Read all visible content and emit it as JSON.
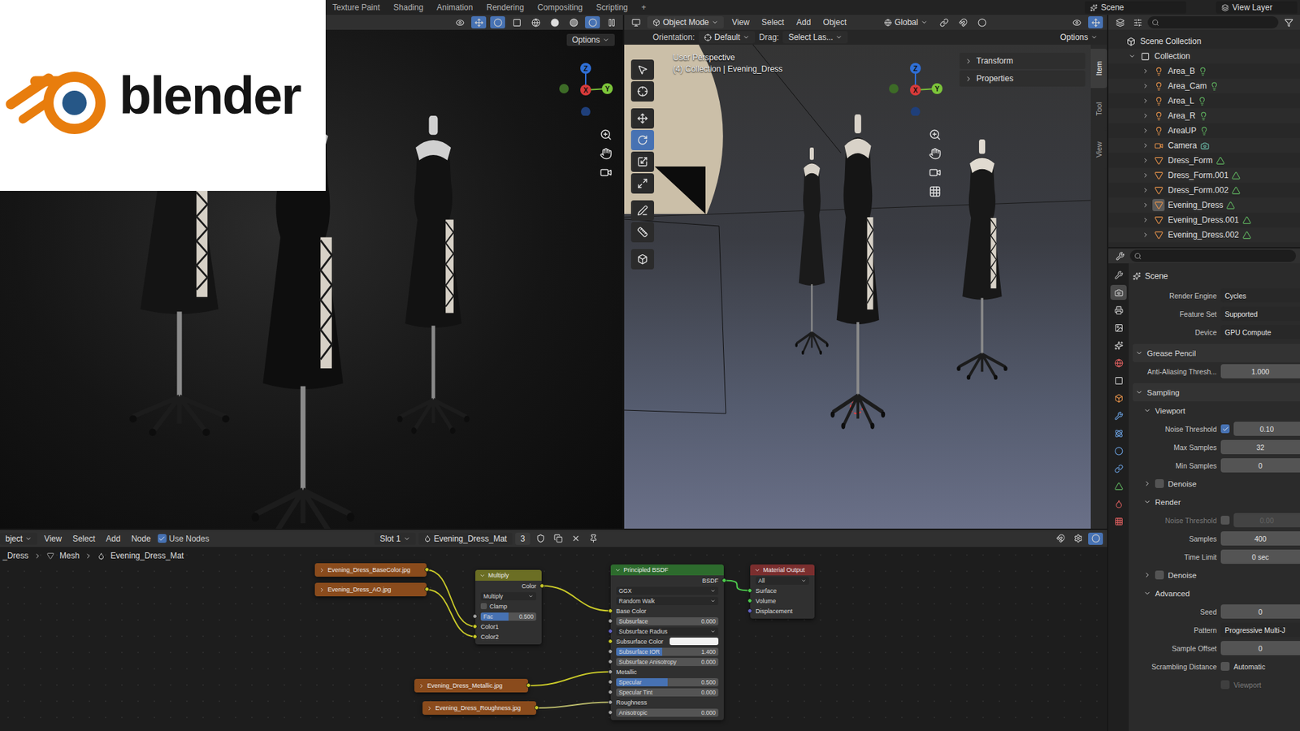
{
  "logo": {
    "text": "blender"
  },
  "workspace_tabs": [
    {
      "label": "Texture Paint",
      "selected": false
    },
    {
      "label": "Shading",
      "selected": false
    },
    {
      "label": "Animation",
      "selected": false
    },
    {
      "label": "Rendering",
      "selected": false
    },
    {
      "label": "Compositing",
      "selected": false
    },
    {
      "label": "Scripting",
      "selected": false
    }
  ],
  "add_workspace": "+",
  "scene": "Scene",
  "view_layer": "View Layer",
  "render_viewport": {
    "options": "Options",
    "gizmo_axes": [
      "Z",
      "X",
      "Y"
    ]
  },
  "viewport": {
    "mode": "Object Mode",
    "menus": [
      "View",
      "Select",
      "Add",
      "Object"
    ],
    "transform_orientation": "Global",
    "orientation_label": "Orientation:",
    "orientation": "Default",
    "drag_label": "Drag:",
    "drag": "Select Las...",
    "options": "Options",
    "perspective": "User Perspective",
    "context": "(4) Collection | Evening_Dress",
    "gizmo_axes": [
      "Z",
      "X",
      "Y"
    ],
    "tools": [
      {
        "selected": false
      },
      {
        "selected": false
      },
      {
        "selected": false
      },
      {
        "selected": true
      },
      {
        "selected": false
      },
      {
        "selected": false
      },
      {
        "selected": false
      },
      {
        "selected": false
      },
      {
        "selected": false
      }
    ],
    "sidebar_tabs": [
      {
        "label": "Item",
        "selected": true
      },
      {
        "label": "Tool",
        "selected": false
      },
      {
        "label": "View",
        "selected": false
      }
    ],
    "panels": [
      {
        "label": "Transform",
        "expanded": false
      },
      {
        "label": "Properties",
        "expanded": false
      }
    ]
  },
  "outliner": {
    "root": "Scene Collection",
    "collection": {
      "name": "Collection",
      "expanded": true
    },
    "items": [
      {
        "name": "Area_B",
        "kind": "light",
        "expanded": false,
        "active": false
      },
      {
        "name": "Area_Cam",
        "kind": "light",
        "expanded": false,
        "active": false
      },
      {
        "name": "Area_L",
        "kind": "light",
        "expanded": false,
        "active": false
      },
      {
        "name": "Area_R",
        "kind": "light",
        "expanded": false,
        "active": false
      },
      {
        "name": "AreaUP",
        "kind": "light",
        "expanded": false,
        "active": false
      },
      {
        "name": "Camera",
        "kind": "camera",
        "expanded": false,
        "active": false
      },
      {
        "name": "Dress_Form",
        "kind": "mesh",
        "expanded": false,
        "active": false
      },
      {
        "name": "Dress_Form.001",
        "kind": "mesh",
        "expanded": false,
        "active": false
      },
      {
        "name": "Dress_Form.002",
        "kind": "mesh",
        "expanded": false,
        "active": false
      },
      {
        "name": "Evening_Dress",
        "kind": "mesh",
        "expanded": false,
        "active": true
      },
      {
        "name": "Evening_Dress.001",
        "kind": "mesh",
        "expanded": false,
        "active": false
      },
      {
        "name": "Evening_Dress.002",
        "kind": "mesh",
        "expanded": false,
        "active": false
      }
    ]
  },
  "properties": {
    "tabs": [
      {
        "selected": false
      },
      {
        "selected": true
      },
      {
        "selected": false
      },
      {
        "selected": false
      },
      {
        "selected": false
      },
      {
        "selected": false
      },
      {
        "selected": false
      },
      {
        "selected": false
      },
      {
        "selected": false
      },
      {
        "selected": false
      },
      {
        "selected": false
      },
      {
        "selected": false
      },
      {
        "selected": false
      },
      {
        "selected": false
      },
      {
        "selected": false
      }
    ],
    "context": "Scene",
    "rows": [
      {
        "kind": "field",
        "label": "Render Engine",
        "value": "Cycles",
        "dropdown": true
      },
      {
        "kind": "field",
        "label": "Feature Set",
        "value": "Supported",
        "dropdown": true
      },
      {
        "kind": "field",
        "label": "Device",
        "value": "GPU Compute",
        "dropdown": true
      },
      {
        "kind": "section",
        "label": "Grease Pencil",
        "expanded": true
      },
      {
        "kind": "field",
        "label": "Anti-Aliasing Thresh...",
        "value": "1.000",
        "dropdown": false
      },
      {
        "kind": "section",
        "label": "Sampling",
        "expanded": true
      },
      {
        "kind": "subsection",
        "label": "Viewport",
        "expanded": true
      },
      {
        "kind": "check-field",
        "label": "Noise Threshold",
        "checked": true,
        "value": "0.10"
      },
      {
        "kind": "field",
        "label": "Max Samples",
        "value": "32",
        "dropdown": false
      },
      {
        "kind": "field",
        "label": "Min Samples",
        "value": "0",
        "dropdown": false
      },
      {
        "kind": "check-subsection",
        "label": "Denoise",
        "checked": false,
        "expanded": false
      },
      {
        "kind": "subsection",
        "label": "Render",
        "expanded": true
      },
      {
        "kind": "check-field",
        "label": "Noise Threshold",
        "checked": false,
        "value": "0.00"
      },
      {
        "kind": "field",
        "label": "Samples",
        "value": "400",
        "dropdown": false
      },
      {
        "kind": "field",
        "label": "Time Limit",
        "value": "0 sec",
        "dropdown": false
      },
      {
        "kind": "check-subsection",
        "label": "Denoise",
        "checked": false,
        "expanded": false
      },
      {
        "kind": "subsection",
        "label": "Advanced",
        "expanded": true
      },
      {
        "kind": "field",
        "label": "Seed",
        "value": "0",
        "dropdown": false
      },
      {
        "kind": "field",
        "label": "Pattern",
        "value": "Progressive Multi-J",
        "dropdown": true
      },
      {
        "kind": "field",
        "label": "Sample Offset",
        "value": "0",
        "dropdown": false
      },
      {
        "kind": "checkbox",
        "label": "Scrambling Distance",
        "option": "Automatic",
        "checked": false,
        "disabled": false
      },
      {
        "kind": "checkbox",
        "option": "Viewport",
        "checked": false,
        "disabled": true
      }
    ]
  },
  "node_editor": {
    "object_menu": "bject",
    "menus": [
      "View",
      "Select",
      "Add",
      "Node"
    ],
    "use_nodes": {
      "label": "Use Nodes",
      "checked": true
    },
    "slot": "Slot 1",
    "material": "Evening_Dress_Mat",
    "users": "3",
    "breadcrumbs": [
      "_Dress",
      "Mesh",
      "Evening_Dress_Mat"
    ],
    "nodes": [
      {
        "kind": "image",
        "title": "Evening_Dress_BaseColor.jpg",
        "color": "#8a4b1c"
      },
      {
        "kind": "image",
        "title": "Evening_Dress_AO.jpg",
        "color": "#8a4b1c"
      },
      {
        "kind": "mix",
        "title": "Multiply",
        "color": "#6b6e24",
        "output": "Color",
        "blend": "Multiply",
        "clamp": {
          "label": "Clamp",
          "checked": false
        },
        "fac": {
          "label": "Fac",
          "value": "0.500",
          "level": 0.5
        },
        "inputs": [
          "Color1",
          "Color2"
        ]
      },
      {
        "kind": "bsdf",
        "title": "Principled BSDF",
        "color": "#2d6b2d",
        "output": "BSDF",
        "dropdowns": [
          "GGX",
          "Random Walk"
        ],
        "inputs": [
          {
            "label": "Base Color",
            "kind": "socket",
            "socket": "color"
          },
          {
            "label": "Subsurface",
            "kind": "value",
            "value": "0.000",
            "level": 0,
            "socket": "float"
          },
          {
            "label": "Subsurface Radius",
            "kind": "dropdown",
            "socket": "vector"
          },
          {
            "label": "Subsurface Color",
            "kind": "swatch",
            "swatch": "#f2f2f2",
            "socket": "color"
          },
          {
            "label": "Subsurface IOR",
            "kind": "value",
            "value": "1.400",
            "level": 0.45,
            "socket": "float"
          },
          {
            "label": "Subsurface Anisotropy",
            "kind": "value",
            "value": "0.000",
            "level": 0,
            "socket": "float"
          },
          {
            "label": "Metallic",
            "kind": "socket",
            "socket": "float"
          },
          {
            "label": "Specular",
            "kind": "value",
            "value": "0.500",
            "level": 0.5,
            "socket": "float"
          },
          {
            "label": "Specular Tint",
            "kind": "value",
            "value": "0.000",
            "level": 0,
            "socket": "float"
          },
          {
            "label": "Roughness",
            "kind": "socket",
            "socket": "float"
          },
          {
            "label": "Anisotropic",
            "kind": "value",
            "value": "0.000",
            "level": 0,
            "socket": "float"
          }
        ]
      },
      {
        "kind": "output",
        "title": "Material Output",
        "color": "#7a2e2e",
        "target": "All",
        "inputs": [
          {
            "label": "Surface",
            "socket": "shader"
          },
          {
            "label": "Volume",
            "socket": "shader"
          },
          {
            "label": "Displacement",
            "socket": "vector"
          }
        ]
      },
      {
        "kind": "image",
        "title": "Evening_Dress_Metallic.jpg",
        "color": "#8a4b1c"
      },
      {
        "kind": "image",
        "title": "Evening_Dress_Roughness.jpg",
        "color": "#8a4b1c"
      }
    ],
    "links": [
      {
        "from": 0,
        "to": 2,
        "socket": "Color1",
        "color": "#c7c729"
      },
      {
        "from": 1,
        "to": 2,
        "socket": "Color2",
        "color": "#c7c729"
      },
      {
        "from": 2,
        "to": 3,
        "socket": "Base Color",
        "color": "#c7c729"
      },
      {
        "from": 5,
        "to": 3,
        "socket": "Metallic",
        "color": "#c7c729"
      },
      {
        "from": 6,
        "to": 3,
        "socket": "Roughness",
        "color": "#b8b86a"
      },
      {
        "from": 3,
        "to": 4,
        "socket": "Surface",
        "color": "#4dcc4d"
      }
    ]
  }
}
